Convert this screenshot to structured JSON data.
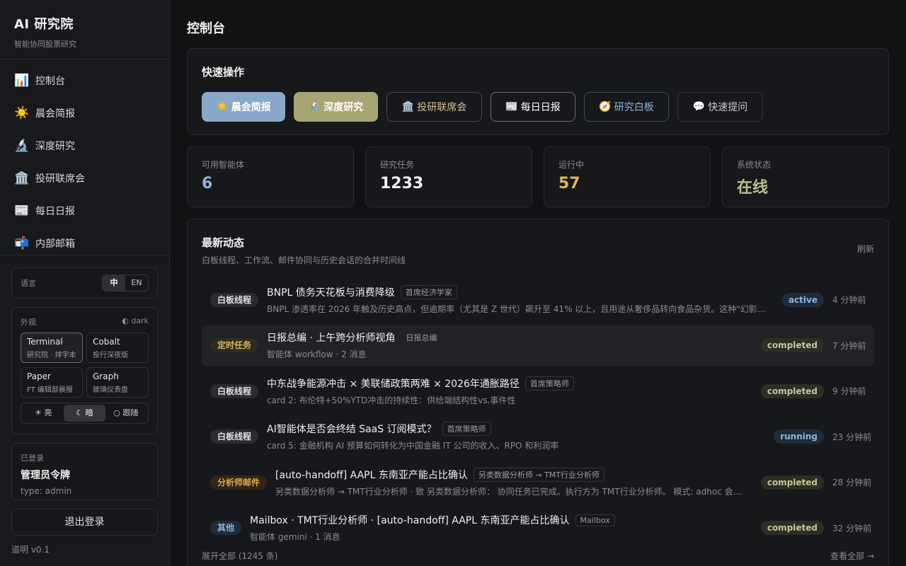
{
  "brand": {
    "title": "AI 研究院",
    "subtitle": "智能协同股票研究"
  },
  "nav": [
    {
      "icon": "📊",
      "icon_name": "bar-chart-icon",
      "label": "控制台"
    },
    {
      "icon": "☀️",
      "icon_name": "sun-icon",
      "label": "晨会简报"
    },
    {
      "icon": "🔬",
      "icon_name": "microscope-icon",
      "label": "深度研究"
    },
    {
      "icon": "🏛️",
      "icon_name": "classical-building-icon",
      "label": "投研联席会"
    },
    {
      "icon": "📰",
      "icon_name": "newspaper-icon",
      "label": "每日日报"
    },
    {
      "icon": "📬",
      "icon_name": "mailbox-icon",
      "label": "内部邮箱"
    }
  ],
  "language": {
    "label": "语言",
    "options": [
      "中",
      "EN"
    ],
    "selected": "中"
  },
  "theme": {
    "label": "外观",
    "mode_indicator": "◐ dark",
    "options": [
      {
        "name": "Terminal",
        "desc": "研究院 · 排字本",
        "selected": true
      },
      {
        "name": "Cobalt",
        "desc": "投行深夜版",
        "selected": false
      },
      {
        "name": "Paper",
        "desc": "FT 编辑部晨报",
        "selected": false
      },
      {
        "name": "Graph",
        "desc": "玻璃仪表盘",
        "selected": false
      }
    ],
    "modes": [
      "☀ 亮",
      "☾ 暗",
      "○ 跟随"
    ],
    "mode_selected": 1
  },
  "user": {
    "status_label": "已登录",
    "name": "管理员令牌",
    "type": "type: admin"
  },
  "logout_label": "退出登录",
  "version": "道明 v0.1",
  "main": {
    "title": "控制台",
    "quick": {
      "title": "快速操作",
      "buttons": [
        {
          "icon": "☀️",
          "icon_name": "sun-icon",
          "label": "晨会简报"
        },
        {
          "icon": "🔬",
          "icon_name": "microscope-icon",
          "label": "深度研究"
        },
        {
          "icon": "🏛️",
          "icon_name": "classical-building-icon",
          "label": "投研联席会"
        },
        {
          "icon": "📰",
          "icon_name": "newspaper-icon",
          "label": "每日日报"
        },
        {
          "icon": "🧭",
          "icon_name": "compass-icon",
          "label": "研究白板"
        },
        {
          "icon": "💬",
          "icon_name": "speech-bubble-icon",
          "label": "快速提问"
        }
      ]
    },
    "stats": [
      {
        "label": "可用智能体",
        "value": "6",
        "color": "#8fb4db"
      },
      {
        "label": "研究任务",
        "value": "1233",
        "color": "#f0f0f0"
      },
      {
        "label": "运行中",
        "value": "57",
        "color": "#e0b45c"
      },
      {
        "label": "系统状态",
        "value": "在线",
        "color": "#b9c08a"
      }
    ],
    "feed": {
      "title": "最新动态",
      "subtitle": "白板线程、工作流、邮件协同与历史会话的合并时间线",
      "refresh_label": "刷新",
      "items": [
        {
          "tag": "白板线程",
          "tag_type": "wb",
          "title": "BNPL 债务天花板与消费降级",
          "chip": "首席经济学家",
          "desc": "BNPL 渗透率在 2026 年触及历史高点，但逾期率（尤其是 Z 世代）飙升至 41% 以上，且用途从奢侈品转向食品杂货。这种\"幻影债...",
          "status": "active",
          "time": "4 分钟前",
          "highlight": false
        },
        {
          "tag": "定时任务",
          "tag_type": "dt",
          "title": "日报总编 · 上午跨分析师视角",
          "chip": "日报总编",
          "desc": "智能体 workflow · 2 消息",
          "status": "completed",
          "time": "7 分钟前",
          "highlight": true
        },
        {
          "tag": "白板线程",
          "tag_type": "wb",
          "title": "中东战争能源冲击 × 美联储政策两难 × 2026年通胀路径",
          "chip": "首席策略师",
          "desc": "card 2: 布伦特+50%YTD冲击的持续性：供给端结构性vs.事件性",
          "status": "completed",
          "time": "9 分钟前",
          "highlight": false
        },
        {
          "tag": "白板线程",
          "tag_type": "wb",
          "title": "AI智能体是否会终结 SaaS 订阅模式？",
          "chip": "首席策略师",
          "desc": "card 5: 金融机构 AI 预算如何转化为中国金融 IT 公司的收入、RPO 和利润率",
          "status": "running",
          "time": "23 分钟前",
          "highlight": false
        },
        {
          "tag": "分析师邮件",
          "tag_type": "mail",
          "title": "[auto-handoff] AAPL 东南亚产能占比确认",
          "chip": "另类数据分析师 → TMT行业分析师",
          "desc": "另类数据分析师 → TMT行业分析师 · 致 另类数据分析师： 协同任务已完成。执行方为 TMT行业分析师。 模式: adhoc 会话: ...",
          "status": "completed",
          "time": "28 分钟前",
          "highlight": false
        },
        {
          "tag": "其他",
          "tag_type": "other",
          "title": "Mailbox · TMT行业分析师 · [auto-handoff] AAPL 东南亚产能占比确认",
          "chip": "Mailbox",
          "desc": "智能体 gemini · 1 消息",
          "status": "completed",
          "time": "32 分钟前",
          "highlight": false
        }
      ],
      "expand_label": "展开全部 (1245 条)",
      "view_all_label": "查看全部 →"
    }
  }
}
